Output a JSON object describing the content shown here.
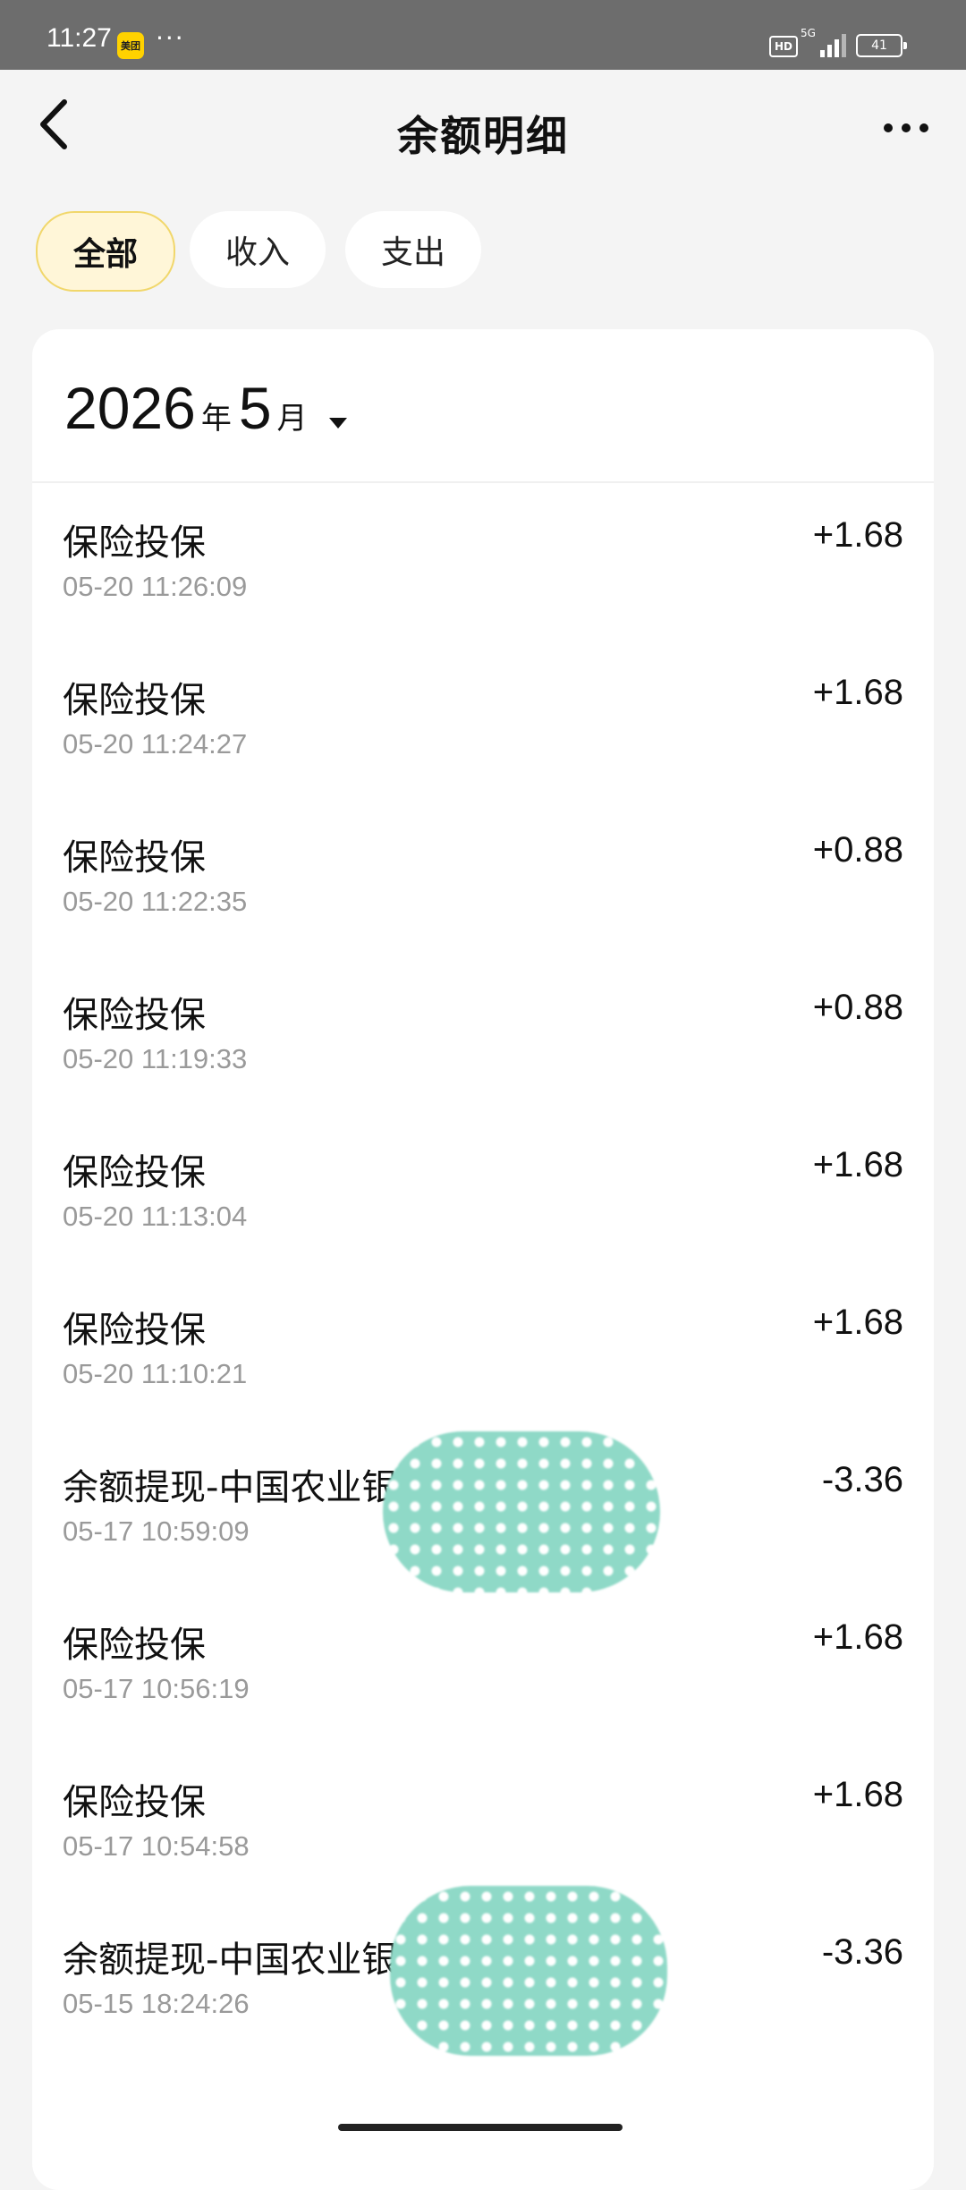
{
  "status_bar": {
    "time": "11:27",
    "app_badge": "美团",
    "dots": "···",
    "hd": "HD",
    "network": "5G",
    "battery": "41"
  },
  "header": {
    "title": "余额明细"
  },
  "filters": [
    {
      "label": "全部",
      "active": true
    },
    {
      "label": "收入",
      "active": false
    },
    {
      "label": "支出",
      "active": false
    }
  ],
  "month_picker": {
    "year": "2026",
    "year_unit": "年",
    "month": "5",
    "month_unit": "月"
  },
  "transactions": [
    {
      "name": "保险投保",
      "time": "05-20 11:26:09",
      "amount": "+1.68"
    },
    {
      "name": "保险投保",
      "time": "05-20 11:24:27",
      "amount": "+1.68"
    },
    {
      "name": "保险投保",
      "time": "05-20 11:22:35",
      "amount": "+0.88"
    },
    {
      "name": "保险投保",
      "time": "05-20 11:19:33",
      "amount": "+0.88"
    },
    {
      "name": "保险投保",
      "time": "05-20 11:13:04",
      "amount": "+1.68"
    },
    {
      "name": "保险投保",
      "time": "05-20 11:10:21",
      "amount": "+1.68"
    },
    {
      "name": "余额提现-中国农业银",
      "time": "05-17 10:59:09",
      "amount": "-3.36"
    },
    {
      "name": "保险投保",
      "time": "05-17 10:56:19",
      "amount": "+1.68"
    },
    {
      "name": "保险投保",
      "time": "05-17 10:54:58",
      "amount": "+1.68"
    },
    {
      "name": "余额提现-中国农业银",
      "time": "05-15 18:24:26",
      "amount": "-3.36"
    }
  ],
  "colors": {
    "active_tab_bg": "#fff6d8",
    "active_tab_border": "#f1d76b",
    "redaction": "#8fd9c7"
  },
  "icons": {
    "back": "chevron-left-icon",
    "more": "more-dots-icon",
    "month": "caret-down-icon"
  }
}
